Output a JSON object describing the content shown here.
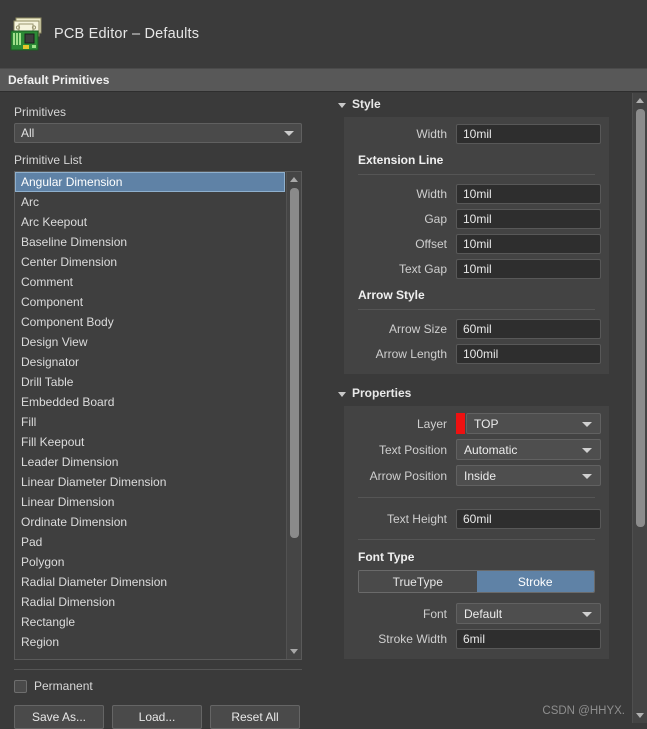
{
  "window": {
    "title": "PCB Editor – Defaults",
    "icon": "pcb-board-icon"
  },
  "section_bar": {
    "label": "Default Primitives"
  },
  "left": {
    "primitives_label": "Primitives",
    "primitives_value": "All",
    "primitive_list_label": "Primitive List",
    "items": [
      "Angular Dimension",
      "Arc",
      "Arc Keepout",
      "Baseline Dimension",
      "Center Dimension",
      "Comment",
      "Component",
      "Component Body",
      "Design View",
      "Designator",
      "Drill Table",
      "Embedded Board",
      "Fill",
      "Fill Keepout",
      "Leader Dimension",
      "Linear Diameter Dimension",
      "Linear Dimension",
      "Ordinate Dimension",
      "Pad",
      "Polygon",
      "Radial Diameter Dimension",
      "Radial Dimension",
      "Rectangle",
      "Region"
    ],
    "selected_index": 0,
    "permanent_label": "Permanent",
    "permanent_checked": false,
    "buttons": [
      "Save As...",
      "Load...",
      "Reset All"
    ]
  },
  "right": {
    "style": {
      "title": "Style",
      "width_label": "Width",
      "width_value": "10mil",
      "extension_line_header": "Extension Line",
      "ext_rows": [
        {
          "label": "Width",
          "value": "10mil"
        },
        {
          "label": "Gap",
          "value": "10mil"
        },
        {
          "label": "Offset",
          "value": "10mil"
        },
        {
          "label": "Text Gap",
          "value": "10mil"
        }
      ],
      "arrow_style_header": "Arrow Style",
      "arrow_rows": [
        {
          "label": "Arrow Size",
          "value": "60mil"
        },
        {
          "label": "Arrow Length",
          "value": "100mil"
        }
      ]
    },
    "properties": {
      "title": "Properties",
      "layer_label": "Layer",
      "layer_value": "TOP",
      "layer_color": "#ee1111",
      "text_position_label": "Text Position",
      "text_position_value": "Automatic",
      "arrow_position_label": "Arrow Position",
      "arrow_position_value": "Inside",
      "text_height_label": "Text Height",
      "text_height_value": "60mil",
      "font_type_header": "Font Type",
      "font_type_options": [
        "TrueType",
        "Stroke"
      ],
      "font_type_selected": "Stroke",
      "font_label": "Font",
      "font_value": "Default",
      "stroke_width_label": "Stroke Width",
      "stroke_width_value": "6mil"
    }
  },
  "watermark": "CSDN @HHYX.",
  "colors": {
    "accent_blue": "#5f82a6",
    "layer_red": "#ee1111",
    "window_bg": "#3a3a3a"
  }
}
